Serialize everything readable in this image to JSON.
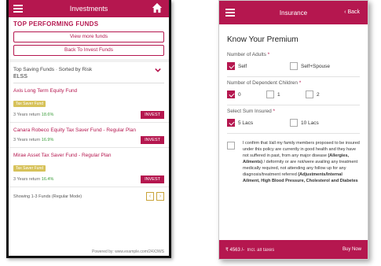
{
  "left_phone": {
    "header": {
      "title": "Investments"
    },
    "section_title": "TOP PERFORMING FUNDS",
    "buttons": {
      "view_more": "View more funds",
      "back": "Back To Invest Funds"
    },
    "filter": {
      "label": "Top Saving Funds · Sorted by Risk",
      "value": "ELSS"
    },
    "funds": [
      {
        "name": "Axis Long Term Equity Fund",
        "badge": "Tax Saver Fund",
        "return_label": "3 Years return",
        "return_value": "18.6%",
        "cta": "INVEST"
      },
      {
        "name": "Canara Robeco Equity Tax Saver Fund - Regular Plan",
        "badge": "",
        "return_label": "3 Years return",
        "return_value": "16.9%",
        "cta": "INVEST"
      },
      {
        "name": "Mirae Asset Tax Saver Fund - Regular Plan",
        "badge": "Tax Saver Fund",
        "return_label": "3 Years return",
        "return_value": "16.4%",
        "cta": "INVEST"
      }
    ],
    "pager": {
      "info": "Showing 1-3 Funds (Regular Mode)",
      "prev": "‹",
      "next": "›"
    },
    "footer": "Powered by: www.example.com/24X3WS"
  },
  "right_phone": {
    "header": {
      "title": "Insurance",
      "back": "Back"
    },
    "title": "Know Your Premium",
    "adults": {
      "label": "Number of Adults",
      "options": [
        {
          "label": "Self",
          "checked": true
        },
        {
          "label": "Self+Spouse",
          "checked": false
        }
      ]
    },
    "children": {
      "label": "Number of Dependent Children",
      "options": [
        {
          "label": "0",
          "checked": true
        },
        {
          "label": "1",
          "checked": false
        },
        {
          "label": "2",
          "checked": false
        }
      ]
    },
    "sum": {
      "label": "Select Sum Insured",
      "options": [
        {
          "label": "5 Lacs",
          "checked": true
        },
        {
          "label": "10 Lacs",
          "checked": false
        }
      ]
    },
    "declaration": {
      "part1": "I confirm that I/all my family members proposed to be insured under this policy are currently in good health and they have not suffered in past, from any major disease ",
      "bold": "(Allergies, Ailments)",
      "part2": " / deformity or are not/were availing any treatment medically required, not attending any follow up for any diagnosis/treatment referred ",
      "bold2": "(Adjustments/Internal Ailment, High Blood Pressure, Cholesterol and Diabetes"
    },
    "bottom": {
      "price": "₹ 4563 /-",
      "price_suffix": "Incl. all taxes",
      "cta": "Buy Now"
    }
  },
  "colors": {
    "brand": "#b5174f",
    "gold": "#d7c25a",
    "green": "#3a9d3a"
  }
}
